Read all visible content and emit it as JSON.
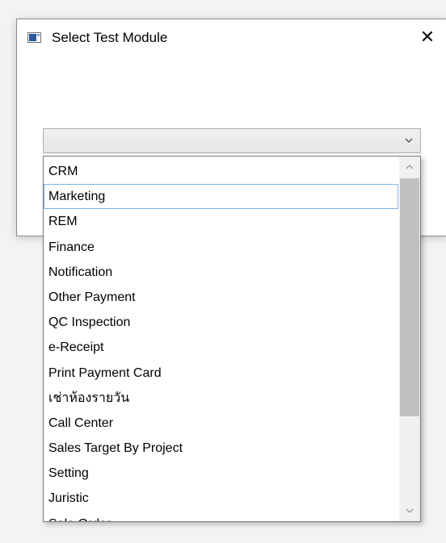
{
  "window": {
    "title": "Select Test Module",
    "close_glyph": "✕"
  },
  "combo": {
    "selected_value": ""
  },
  "dropdown": {
    "items": [
      "CRM",
      "Marketing",
      "REM",
      "Finance",
      "Notification",
      "Other Payment",
      "QC Inspection",
      "e-Receipt",
      "Print Payment Card",
      "เช่าห้องรายวัน",
      "Call Center",
      "Sales Target By Project",
      "Setting",
      "Juristic",
      "Sale Order"
    ],
    "highlighted_index": 1,
    "scroll_position_fraction": 0.0
  },
  "icons": {
    "app": "window-app-icon",
    "close": "close-icon",
    "combo_arrow": "chevron-down-icon",
    "scroll_up": "chevron-up-icon",
    "scroll_down": "chevron-down-icon"
  },
  "colors": {
    "highlight_border": "#7eb4ea",
    "scroll_thumb": "#c1c1c1",
    "scroll_track": "#f0f0f0"
  }
}
